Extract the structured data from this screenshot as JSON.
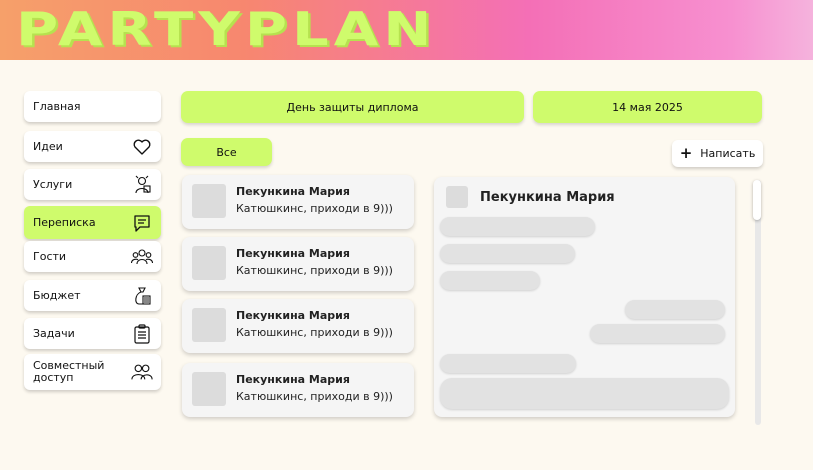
{
  "app": {
    "logo": "PARTYPLAN"
  },
  "sidebar": {
    "items": [
      {
        "label": "Главная",
        "icon": ""
      },
      {
        "label": "Идеи",
        "icon": "heart-icon"
      },
      {
        "label": "Услуги",
        "icon": "services-person-icon"
      },
      {
        "label": "Переписка",
        "icon": "chat-icon",
        "active": true
      },
      {
        "label": "Гости",
        "icon": "guests-icon"
      },
      {
        "label": "Бюджет",
        "icon": "money-bag-icon"
      },
      {
        "label": "Задачи",
        "icon": "clipboard-icon"
      },
      {
        "label": "Совместный доступ",
        "icon": "shared-users-icon"
      }
    ]
  },
  "event": {
    "name": "День защиты диплома",
    "date": "14 мая 2025"
  },
  "filters": {
    "all": "Все"
  },
  "toolbar": {
    "write_label": "Написать"
  },
  "chats": [
    {
      "name": "Пекункина Мария",
      "message": "Катюшкинс, приходи в 9)))"
    },
    {
      "name": "Пекункина Мария",
      "message": "Катюшкинс, приходи в 9)))"
    },
    {
      "name": "Пекункина Мария",
      "message": "Катюшкинс, приходи в 9)))"
    },
    {
      "name": "Пекункина Мария",
      "message": "Катюшкинс, приходи в 9)))"
    }
  ],
  "conversation": {
    "name": "Пекункина Мария"
  },
  "colors": {
    "accent": "#cffb6c",
    "background": "#fdf9f0",
    "card": "#f5f5f5"
  }
}
